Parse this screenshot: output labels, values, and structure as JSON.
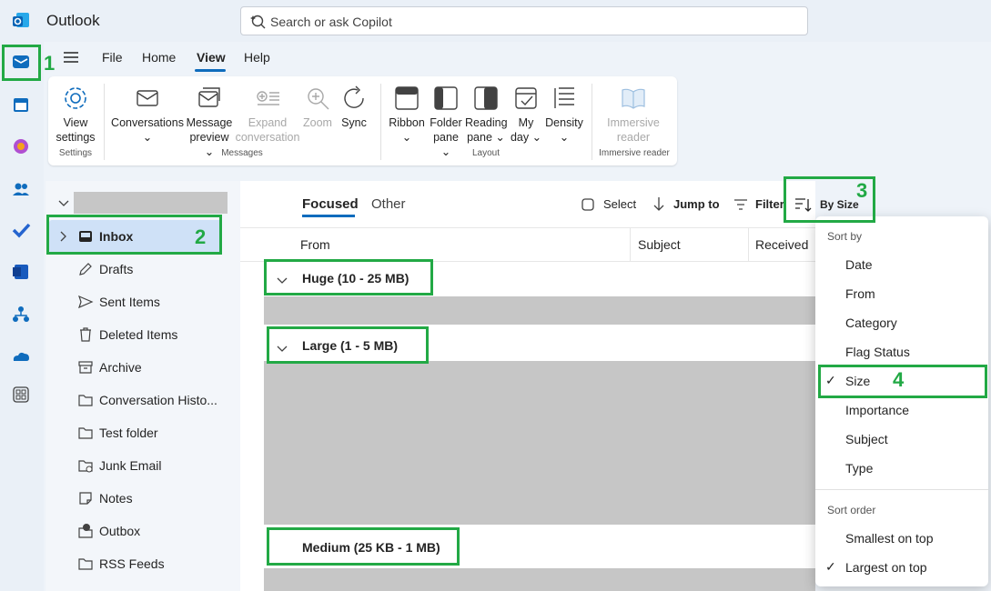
{
  "app": {
    "title": "Outlook"
  },
  "search": {
    "placeholder": "Search or ask Copilot"
  },
  "menu": {
    "tabs": [
      "File",
      "Home",
      "View",
      "Help"
    ],
    "active": "View"
  },
  "ribbon": {
    "buttons": [
      {
        "line1": "View",
        "line2": "settings",
        "icon": "gear-icon"
      },
      {
        "line1": "Conversations",
        "line2": "⌄",
        "icon": "conversations-icon"
      },
      {
        "line1": "Message",
        "line2": "preview ⌄",
        "icon": "message-preview-icon"
      },
      {
        "line1": "Expand",
        "line2": "conversation",
        "icon": "expand-conversation-icon"
      },
      {
        "line1": "Zoom",
        "line2": "",
        "icon": "zoom-icon"
      },
      {
        "line1": "Sync",
        "line2": "",
        "icon": "sync-icon"
      },
      {
        "line1": "Ribbon",
        "line2": "⌄",
        "icon": "ribbon-icon"
      },
      {
        "line1": "Folder",
        "line2": "pane ⌄",
        "icon": "folder-pane-icon"
      },
      {
        "line1": "Reading",
        "line2": "pane ⌄",
        "icon": "reading-pane-icon"
      },
      {
        "line1": "My",
        "line2": "day ⌄",
        "icon": "my-day-icon"
      },
      {
        "line1": "Density",
        "line2": "⌄",
        "icon": "density-icon"
      },
      {
        "line1": "Immersive",
        "line2": "reader",
        "icon": "immersive-reader-icon"
      }
    ],
    "groups": [
      "Settings",
      "Messages",
      "Layout",
      "Immersive reader"
    ]
  },
  "folders": [
    {
      "label": "Inbox",
      "icon": "inbox-icon"
    },
    {
      "label": "Drafts",
      "icon": "pencil-icon"
    },
    {
      "label": "Sent Items",
      "icon": "send-icon"
    },
    {
      "label": "Deleted Items",
      "icon": "trash-icon"
    },
    {
      "label": "Archive",
      "icon": "archive-icon"
    },
    {
      "label": "Conversation Histo...",
      "icon": "folder-icon"
    },
    {
      "label": "Test folder",
      "icon": "folder-icon"
    },
    {
      "label": "Junk Email",
      "icon": "junk-icon"
    },
    {
      "label": "Notes",
      "icon": "notes-icon"
    },
    {
      "label": "Outbox",
      "icon": "outbox-icon"
    },
    {
      "label": "RSS Feeds",
      "icon": "folder-icon"
    }
  ],
  "list": {
    "tabs": [
      "Focused",
      "Other"
    ],
    "toolbar": {
      "select": "Select",
      "jump": "Jump to",
      "filter": "Filter",
      "sort": "By Size"
    },
    "columns": [
      "From",
      "Subject",
      "Received"
    ],
    "groups": [
      "Huge (10 - 25 MB)",
      "Large (1 - 5 MB)",
      "Medium (25 KB - 1 MB)"
    ]
  },
  "sortmenu": {
    "sort_by_header": "Sort by",
    "sort_by": [
      "Date",
      "From",
      "Category",
      "Flag Status",
      "Size",
      "Importance",
      "Subject",
      "Type"
    ],
    "checked_sort_by": "Size",
    "sort_order_header": "Sort order",
    "sort_order": [
      "Smallest on top",
      "Largest on top"
    ],
    "checked_sort_order": "Largest on top",
    "check_glyph": "✓"
  },
  "callouts": [
    "1",
    "2",
    "3",
    "4"
  ],
  "colors": {
    "accent": "#0f6cbd",
    "callout": "#22a945"
  }
}
